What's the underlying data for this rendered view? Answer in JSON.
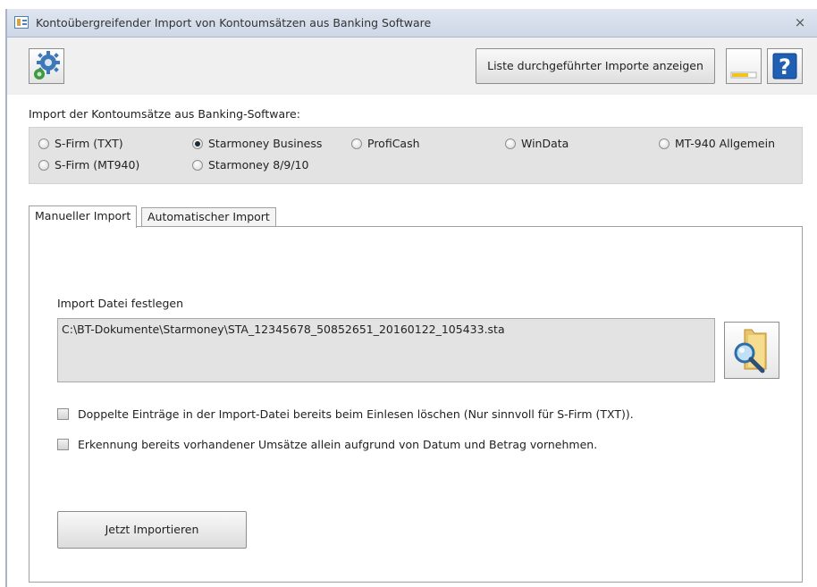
{
  "window": {
    "title": "Kontoübergreifender Import von Kontoumsätzen aus Banking Software",
    "close_glyph": "×"
  },
  "toolbar": {
    "settings_icon": "gear-icon",
    "list_button_label": "Liste durchgeführter Importe anzeigen",
    "color_icon": "color-swatch-icon",
    "help_icon": "help-icon",
    "help_glyph": "?"
  },
  "import_source": {
    "label": "Import der Kontoumsätze aus Banking-Software:",
    "options": [
      {
        "label": "S-Firm (TXT)",
        "selected": false
      },
      {
        "label": "Starmoney Business",
        "selected": true
      },
      {
        "label": "ProfiCash",
        "selected": false
      },
      {
        "label": "WinData",
        "selected": false
      },
      {
        "label": "MT-940 Allgemein",
        "selected": false
      },
      {
        "label": "S-Firm (MT940)",
        "selected": false
      },
      {
        "label": "Starmoney 8/9/10",
        "selected": false
      }
    ]
  },
  "tabs": [
    {
      "label": "Manueller Import",
      "active": true
    },
    {
      "label": "Automatischer Import",
      "active": false
    }
  ],
  "manual_import": {
    "file_label": "Import Datei festlegen",
    "file_path": "C:\\BT-Dokumente\\Starmoney\\STA_12345678_50852651_20160122_105433.sta",
    "browse_icon": "folder-search-icon",
    "checkboxes": [
      {
        "label": "Doppelte Einträge in der Import-Datei bereits beim Einlesen löschen (Nur sinnvoll für S-Firm (TXT)).",
        "checked": false
      },
      {
        "label": "Erkennung bereits vorhandener Umsätze allein aufgrund von Datum und Betrag vornehmen.",
        "checked": false
      }
    ],
    "import_button_label": "Jetzt Importieren"
  },
  "colors": {
    "title_bar": "#d6deeb",
    "panel_gray": "#e3e3e3",
    "help_blue": "#1f5fb4",
    "gear_blue": "#3e78b8"
  }
}
